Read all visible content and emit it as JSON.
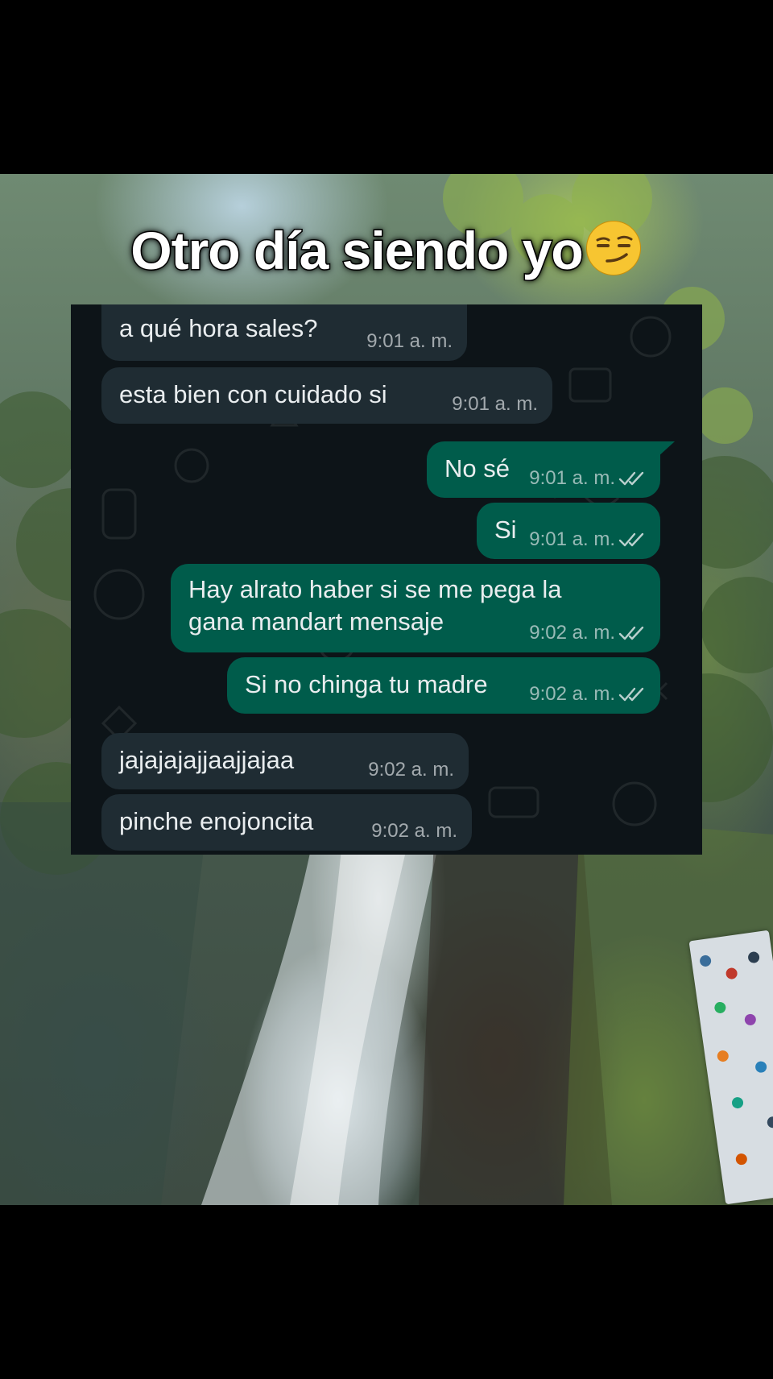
{
  "caption": {
    "text": "Otro día siendo yo",
    "emoji_name": "smirking-face"
  },
  "messages": [
    {
      "direction": "incoming",
      "text": "a qué hora sales?",
      "time": "9:01 a. m."
    },
    {
      "direction": "incoming",
      "text": "esta bien con cuidado si",
      "time": "9:01 a. m."
    },
    {
      "direction": "outgoing",
      "text": "No sé",
      "time": "9:01 a. m.",
      "status": "read"
    },
    {
      "direction": "outgoing",
      "text": "Si",
      "time": "9:01 a. m.",
      "status": "read"
    },
    {
      "direction": "outgoing",
      "text_lines": [
        "Hay alrato haber si se me pega la",
        "gana mandart mensaje"
      ],
      "time": "9:02 a. m.",
      "status": "read"
    },
    {
      "direction": "outgoing",
      "text": "Si no chinga tu madre",
      "time": "9:02 a. m.",
      "status": "read"
    },
    {
      "direction": "incoming",
      "text": "jajajajajjaajjajaa",
      "time": "9:02 a. m."
    },
    {
      "direction": "incoming",
      "text": "pinche enojoncita",
      "time": "9:02 a. m."
    }
  ],
  "colors": {
    "chat_background": "#0d1418",
    "incoming_bubble": "#1f2c33",
    "outgoing_bubble": "#005c4b",
    "check_icon": "#e9edef"
  }
}
